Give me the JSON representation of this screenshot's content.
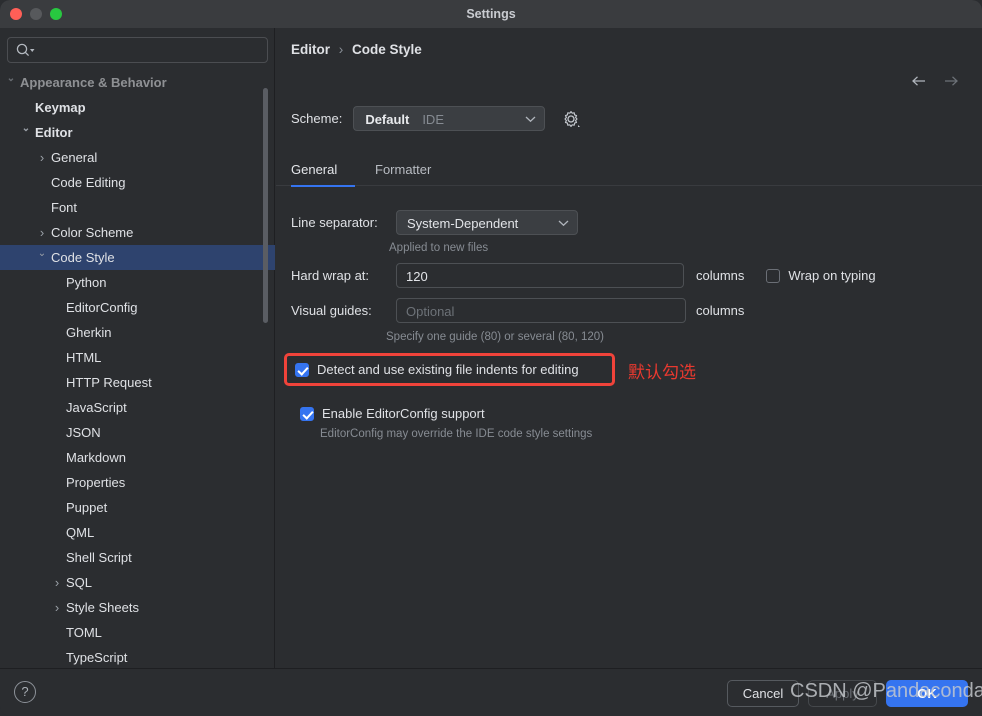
{
  "window": {
    "title": "Settings",
    "traffic_lights": [
      "close-red",
      "minimize-inactive",
      "zoom-green"
    ]
  },
  "sidebar": {
    "search": {
      "value": "",
      "placeholder": ""
    },
    "items": [
      {
        "label": "Appearance & Behavior",
        "indent": 20,
        "twisty": "chevron-down",
        "bold": true,
        "selected": false,
        "faded": true
      },
      {
        "label": "Keymap",
        "indent": 35,
        "twisty": "",
        "bold": true,
        "selected": false,
        "faded": false
      },
      {
        "label": "Editor",
        "indent": 35,
        "twisty": "chevron-down",
        "bold": true,
        "selected": false,
        "faded": false
      },
      {
        "label": "General",
        "indent": 51,
        "twisty": "chevron-right",
        "bold": false,
        "selected": false,
        "faded": false
      },
      {
        "label": "Code Editing",
        "indent": 51,
        "twisty": "",
        "bold": false,
        "selected": false,
        "faded": false
      },
      {
        "label": "Font",
        "indent": 51,
        "twisty": "",
        "bold": false,
        "selected": false,
        "faded": false
      },
      {
        "label": "Color Scheme",
        "indent": 51,
        "twisty": "chevron-right",
        "bold": false,
        "selected": false,
        "faded": false
      },
      {
        "label": "Code Style",
        "indent": 51,
        "twisty": "chevron-down",
        "bold": false,
        "selected": true,
        "faded": false
      },
      {
        "label": "Python",
        "indent": 66,
        "twisty": "",
        "bold": false,
        "selected": false,
        "faded": false
      },
      {
        "label": "EditorConfig",
        "indent": 66,
        "twisty": "",
        "bold": false,
        "selected": false,
        "faded": false
      },
      {
        "label": "Gherkin",
        "indent": 66,
        "twisty": "",
        "bold": false,
        "selected": false,
        "faded": false
      },
      {
        "label": "HTML",
        "indent": 66,
        "twisty": "",
        "bold": false,
        "selected": false,
        "faded": false
      },
      {
        "label": "HTTP Request",
        "indent": 66,
        "twisty": "",
        "bold": false,
        "selected": false,
        "faded": false
      },
      {
        "label": "JavaScript",
        "indent": 66,
        "twisty": "",
        "bold": false,
        "selected": false,
        "faded": false
      },
      {
        "label": "JSON",
        "indent": 66,
        "twisty": "",
        "bold": false,
        "selected": false,
        "faded": false
      },
      {
        "label": "Markdown",
        "indent": 66,
        "twisty": "",
        "bold": false,
        "selected": false,
        "faded": false
      },
      {
        "label": "Properties",
        "indent": 66,
        "twisty": "",
        "bold": false,
        "selected": false,
        "faded": false
      },
      {
        "label": "Puppet",
        "indent": 66,
        "twisty": "",
        "bold": false,
        "selected": false,
        "faded": false
      },
      {
        "label": "QML",
        "indent": 66,
        "twisty": "",
        "bold": false,
        "selected": false,
        "faded": false
      },
      {
        "label": "Shell Script",
        "indent": 66,
        "twisty": "",
        "bold": false,
        "selected": false,
        "faded": false
      },
      {
        "label": "SQL",
        "indent": 66,
        "twisty": "chevron-right",
        "bold": false,
        "selected": false,
        "faded": false
      },
      {
        "label": "Style Sheets",
        "indent": 66,
        "twisty": "chevron-right",
        "bold": false,
        "selected": false,
        "faded": false
      },
      {
        "label": "TOML",
        "indent": 66,
        "twisty": "",
        "bold": false,
        "selected": false,
        "faded": false
      },
      {
        "label": "TypeScript",
        "indent": 66,
        "twisty": "",
        "bold": false,
        "selected": false,
        "faded": false
      }
    ]
  },
  "main": {
    "breadcrumb": {
      "parent": "Editor",
      "separator": "›",
      "current": "Code Style"
    },
    "nav": {
      "back": "arrow-left-icon",
      "forward": "arrow-right-icon"
    },
    "scheme": {
      "label": "Scheme:",
      "value": "Default",
      "suffix": "IDE",
      "gear": "gear-icon"
    },
    "tabs": [
      {
        "label": "General",
        "active": true
      },
      {
        "label": "Formatter",
        "active": false
      }
    ],
    "form": {
      "line_separator": {
        "label": "Line separator:",
        "value": "System-Dependent",
        "hint": "Applied to new files"
      },
      "hard_wrap": {
        "label": "Hard wrap at:",
        "value": "120",
        "unit": "columns"
      },
      "wrap_on_typing": {
        "label": "Wrap on typing",
        "checked": false
      },
      "visual_guides": {
        "label": "Visual guides:",
        "placeholder": "Optional",
        "unit": "columns",
        "hint": "Specify one guide (80) or several (80, 120)"
      },
      "detect_indents": {
        "label": "Detect and use existing file indents for editing",
        "checked": true
      },
      "editorconfig": {
        "label": "Enable EditorConfig support",
        "checked": true,
        "hint": "EditorConfig may override the IDE code style settings"
      }
    },
    "annotation": {
      "text": "默认勾选",
      "color": "#e8392f"
    }
  },
  "footer": {
    "help": "?",
    "cancel": "Cancel",
    "apply": "Apply",
    "ok": "OK"
  },
  "watermark": {
    "text": "CSDN @Pandaconda"
  },
  "colors": {
    "accent": "#3574f0",
    "selection": "#2e436e",
    "background": "#2b2d30",
    "annotation_red": "#e8392f"
  }
}
